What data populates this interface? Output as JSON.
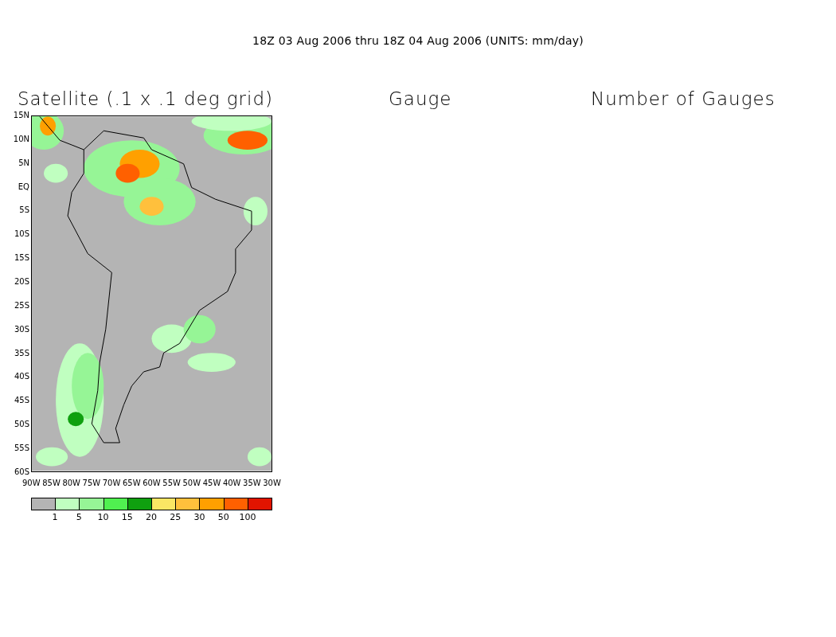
{
  "title": "18Z 03 Aug 2006 thru 18Z 04 Aug 2006 (UNITS: mm/day)",
  "panels": [
    {
      "title": "Satellite (.1 x .1 deg grid)"
    },
    {
      "title": "Gauge"
    },
    {
      "title": "Number of Gauges"
    }
  ],
  "map": {
    "y_ticks": [
      "15N",
      "10N",
      "5N",
      "EQ",
      "5S",
      "10S",
      "15S",
      "20S",
      "25S",
      "30S",
      "35S",
      "40S",
      "45S",
      "50S",
      "55S",
      "60S"
    ],
    "x_ticks": [
      "90W",
      "85W",
      "80W",
      "75W",
      "70W",
      "65W",
      "60W",
      "55W",
      "50W",
      "45W",
      "40W",
      "35W",
      "30W"
    ]
  },
  "legend": {
    "segments": [
      {
        "color": "#b4b4b4"
      },
      {
        "color": "#c0ffc0"
      },
      {
        "color": "#96f596"
      },
      {
        "color": "#50f050"
      },
      {
        "color": "#0fa00f"
      },
      {
        "color": "#fae664"
      },
      {
        "color": "#ffc03c"
      },
      {
        "color": "#ffa000"
      },
      {
        "color": "#ff6000"
      },
      {
        "color": "#e11400"
      }
    ],
    "labels": [
      "1",
      "5",
      "10",
      "15",
      "20",
      "25",
      "30",
      "50",
      "100"
    ]
  }
}
